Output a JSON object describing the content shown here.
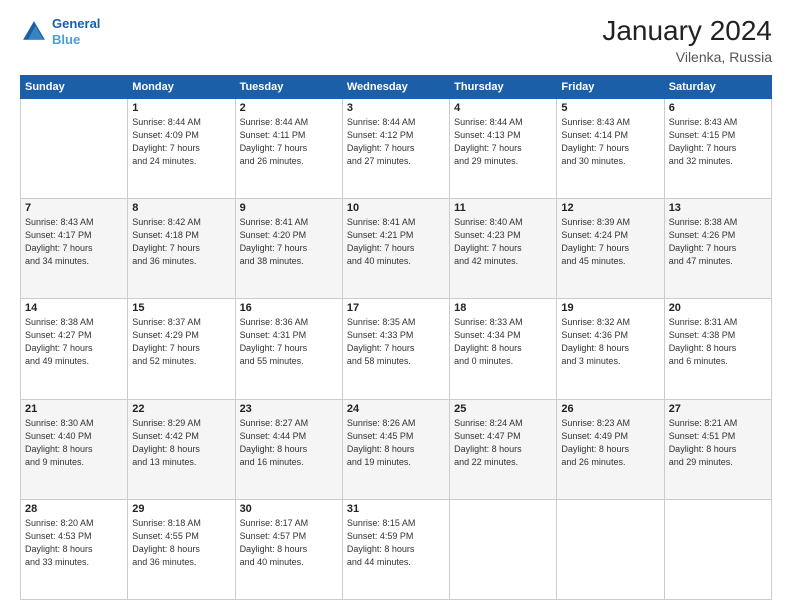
{
  "header": {
    "logo_line1": "General",
    "logo_line2": "Blue",
    "title": "January 2024",
    "subtitle": "Vilenka, Russia"
  },
  "weekdays": [
    "Sunday",
    "Monday",
    "Tuesday",
    "Wednesday",
    "Thursday",
    "Friday",
    "Saturday"
  ],
  "weeks": [
    [
      {
        "day": "",
        "info": ""
      },
      {
        "day": "1",
        "info": "Sunrise: 8:44 AM\nSunset: 4:09 PM\nDaylight: 7 hours\nand 24 minutes."
      },
      {
        "day": "2",
        "info": "Sunrise: 8:44 AM\nSunset: 4:11 PM\nDaylight: 7 hours\nand 26 minutes."
      },
      {
        "day": "3",
        "info": "Sunrise: 8:44 AM\nSunset: 4:12 PM\nDaylight: 7 hours\nand 27 minutes."
      },
      {
        "day": "4",
        "info": "Sunrise: 8:44 AM\nSunset: 4:13 PM\nDaylight: 7 hours\nand 29 minutes."
      },
      {
        "day": "5",
        "info": "Sunrise: 8:43 AM\nSunset: 4:14 PM\nDaylight: 7 hours\nand 30 minutes."
      },
      {
        "day": "6",
        "info": "Sunrise: 8:43 AM\nSunset: 4:15 PM\nDaylight: 7 hours\nand 32 minutes."
      }
    ],
    [
      {
        "day": "7",
        "info": "Sunrise: 8:43 AM\nSunset: 4:17 PM\nDaylight: 7 hours\nand 34 minutes."
      },
      {
        "day": "8",
        "info": "Sunrise: 8:42 AM\nSunset: 4:18 PM\nDaylight: 7 hours\nand 36 minutes."
      },
      {
        "day": "9",
        "info": "Sunrise: 8:41 AM\nSunset: 4:20 PM\nDaylight: 7 hours\nand 38 minutes."
      },
      {
        "day": "10",
        "info": "Sunrise: 8:41 AM\nSunset: 4:21 PM\nDaylight: 7 hours\nand 40 minutes."
      },
      {
        "day": "11",
        "info": "Sunrise: 8:40 AM\nSunset: 4:23 PM\nDaylight: 7 hours\nand 42 minutes."
      },
      {
        "day": "12",
        "info": "Sunrise: 8:39 AM\nSunset: 4:24 PM\nDaylight: 7 hours\nand 45 minutes."
      },
      {
        "day": "13",
        "info": "Sunrise: 8:38 AM\nSunset: 4:26 PM\nDaylight: 7 hours\nand 47 minutes."
      }
    ],
    [
      {
        "day": "14",
        "info": "Sunrise: 8:38 AM\nSunset: 4:27 PM\nDaylight: 7 hours\nand 49 minutes."
      },
      {
        "day": "15",
        "info": "Sunrise: 8:37 AM\nSunset: 4:29 PM\nDaylight: 7 hours\nand 52 minutes."
      },
      {
        "day": "16",
        "info": "Sunrise: 8:36 AM\nSunset: 4:31 PM\nDaylight: 7 hours\nand 55 minutes."
      },
      {
        "day": "17",
        "info": "Sunrise: 8:35 AM\nSunset: 4:33 PM\nDaylight: 7 hours\nand 58 minutes."
      },
      {
        "day": "18",
        "info": "Sunrise: 8:33 AM\nSunset: 4:34 PM\nDaylight: 8 hours\nand 0 minutes."
      },
      {
        "day": "19",
        "info": "Sunrise: 8:32 AM\nSunset: 4:36 PM\nDaylight: 8 hours\nand 3 minutes."
      },
      {
        "day": "20",
        "info": "Sunrise: 8:31 AM\nSunset: 4:38 PM\nDaylight: 8 hours\nand 6 minutes."
      }
    ],
    [
      {
        "day": "21",
        "info": "Sunrise: 8:30 AM\nSunset: 4:40 PM\nDaylight: 8 hours\nand 9 minutes."
      },
      {
        "day": "22",
        "info": "Sunrise: 8:29 AM\nSunset: 4:42 PM\nDaylight: 8 hours\nand 13 minutes."
      },
      {
        "day": "23",
        "info": "Sunrise: 8:27 AM\nSunset: 4:44 PM\nDaylight: 8 hours\nand 16 minutes."
      },
      {
        "day": "24",
        "info": "Sunrise: 8:26 AM\nSunset: 4:45 PM\nDaylight: 8 hours\nand 19 minutes."
      },
      {
        "day": "25",
        "info": "Sunrise: 8:24 AM\nSunset: 4:47 PM\nDaylight: 8 hours\nand 22 minutes."
      },
      {
        "day": "26",
        "info": "Sunrise: 8:23 AM\nSunset: 4:49 PM\nDaylight: 8 hours\nand 26 minutes."
      },
      {
        "day": "27",
        "info": "Sunrise: 8:21 AM\nSunset: 4:51 PM\nDaylight: 8 hours\nand 29 minutes."
      }
    ],
    [
      {
        "day": "28",
        "info": "Sunrise: 8:20 AM\nSunset: 4:53 PM\nDaylight: 8 hours\nand 33 minutes."
      },
      {
        "day": "29",
        "info": "Sunrise: 8:18 AM\nSunset: 4:55 PM\nDaylight: 8 hours\nand 36 minutes."
      },
      {
        "day": "30",
        "info": "Sunrise: 8:17 AM\nSunset: 4:57 PM\nDaylight: 8 hours\nand 40 minutes."
      },
      {
        "day": "31",
        "info": "Sunrise: 8:15 AM\nSunset: 4:59 PM\nDaylight: 8 hours\nand 44 minutes."
      },
      {
        "day": "",
        "info": ""
      },
      {
        "day": "",
        "info": ""
      },
      {
        "day": "",
        "info": ""
      }
    ]
  ]
}
